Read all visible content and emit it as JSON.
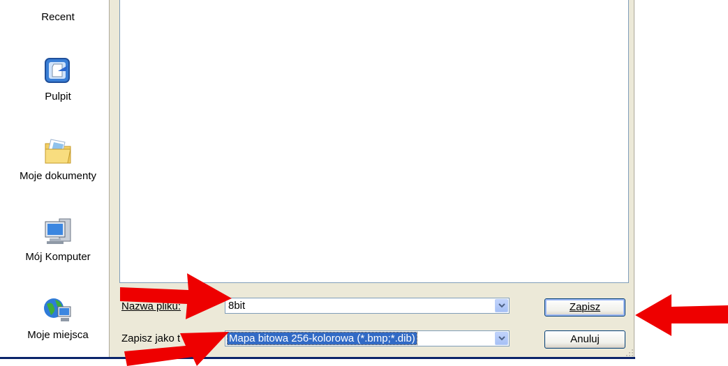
{
  "places": [
    {
      "label": "Recent",
      "icon": "recent-icon"
    },
    {
      "label": "Pulpit",
      "icon": "desktop-icon"
    },
    {
      "label": "Moje dokumenty",
      "icon": "documents-folder-icon"
    },
    {
      "label": "Mój Komputer",
      "icon": "computer-icon"
    },
    {
      "label": "Moje miejsca",
      "icon": "network-places-icon"
    }
  ],
  "filename": {
    "label": "Nazwa pliku:",
    "value": "8bit"
  },
  "filetype": {
    "label": "Zapisz jako t",
    "value": "Mapa bitowa 256-kolorowa (*.bmp;*.dib)"
  },
  "buttons": {
    "save": "Zapisz",
    "cancel": "Anuluj"
  },
  "colors": {
    "arrow": "#ee0000",
    "dialog_bg": "#ece9d8",
    "selection": "#316ac5"
  }
}
